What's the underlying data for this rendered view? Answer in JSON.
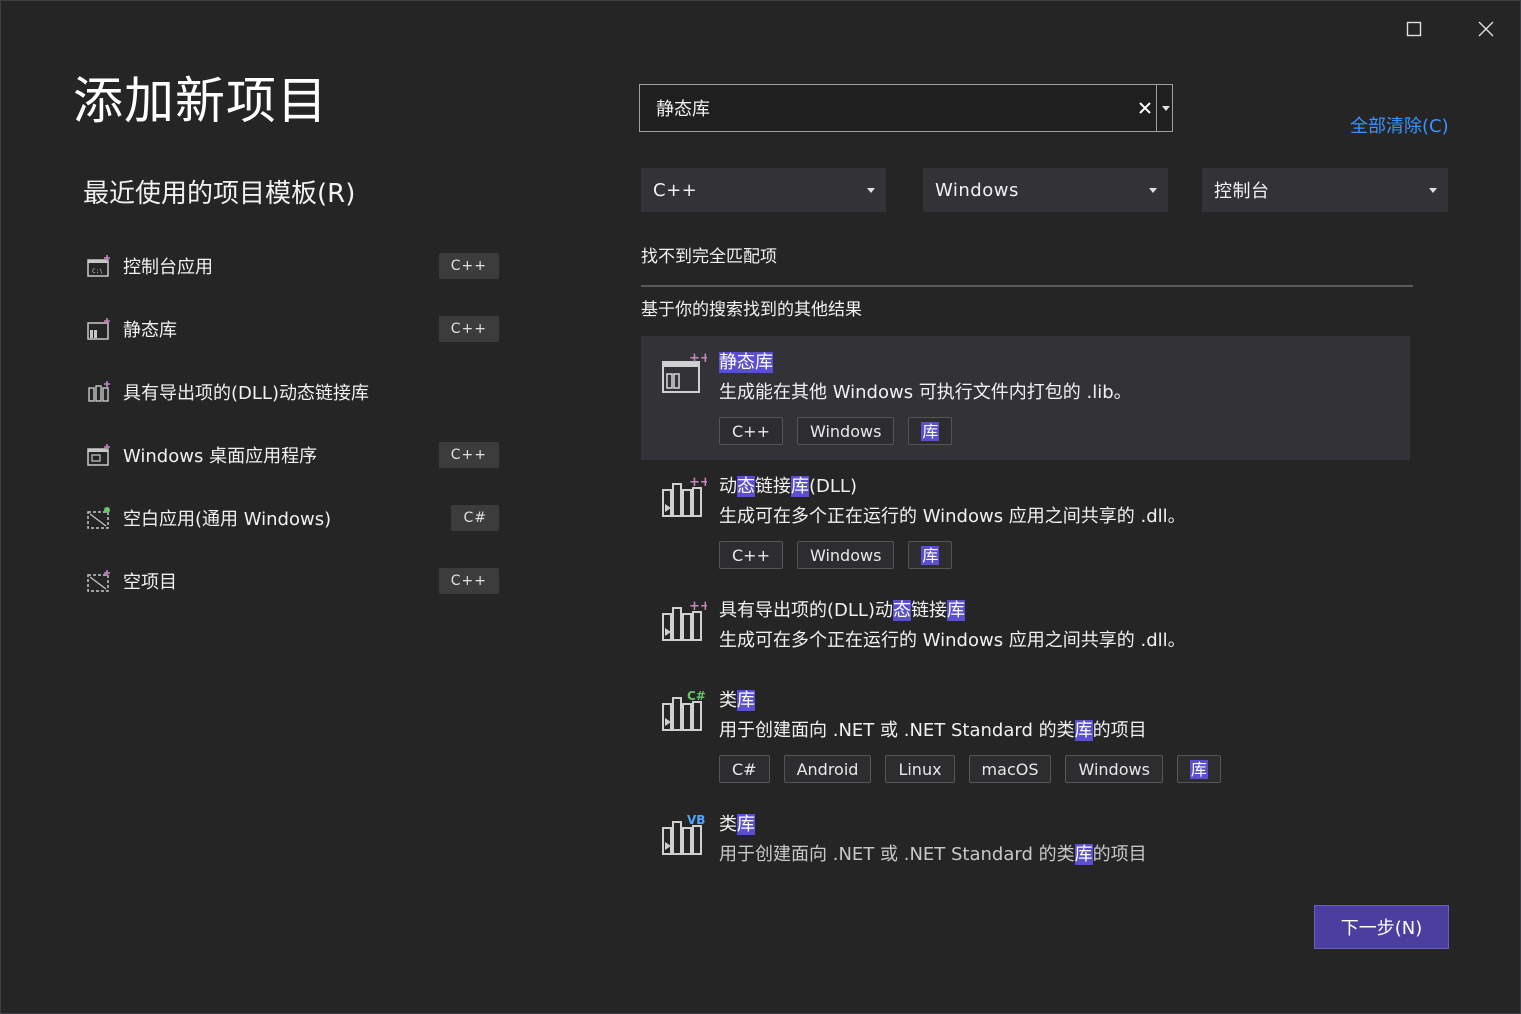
{
  "window": {
    "title": "添加新项目"
  },
  "recent": {
    "heading": "最近使用的项目模板(R)",
    "items": [
      {
        "label": "控制台应用",
        "lang": "C++"
      },
      {
        "label": "静态库",
        "lang": "C++"
      },
      {
        "label": "具有导出项的(DLL)动态链接库",
        "lang": ""
      },
      {
        "label": "Windows 桌面应用程序",
        "lang": "C++"
      },
      {
        "label": "空白应用(通用 Windows)",
        "lang": "C#"
      },
      {
        "label": "空项目",
        "lang": "C++"
      }
    ]
  },
  "search": {
    "value": "静态库",
    "clear_all": "全部清除(C)"
  },
  "filters": {
    "language": "C++",
    "platform": "Windows",
    "project_type": "控制台"
  },
  "results": {
    "no_match": "找不到完全匹配项",
    "other_heading": "基于你的搜索找到的其他结果",
    "items": [
      {
        "title_parts": [
          {
            "t": "静态库",
            "h": true
          }
        ],
        "desc_parts": [
          {
            "t": "生成能在其他 Windows 可执行文件内打包的 .lib。",
            "h": false
          }
        ],
        "tags": [
          {
            "t": "C++"
          },
          {
            "t": "Windows"
          },
          {
            "t": "库",
            "h": true
          }
        ]
      },
      {
        "title_parts": [
          {
            "t": "动",
            "h": false
          },
          {
            "t": "态",
            "h": true
          },
          {
            "t": "链接",
            "h": false
          },
          {
            "t": "库",
            "h": true
          },
          {
            "t": "(DLL)",
            "h": false
          }
        ],
        "desc_parts": [
          {
            "t": "生成可在多个正在运行的 Windows 应用之间共享的 .dll。",
            "h": false
          }
        ],
        "tags": [
          {
            "t": "C++"
          },
          {
            "t": "Windows"
          },
          {
            "t": "库",
            "h": true
          }
        ]
      },
      {
        "title_parts": [
          {
            "t": "具有导出项的(DLL)动",
            "h": false
          },
          {
            "t": "态",
            "h": true
          },
          {
            "t": "链接",
            "h": false
          },
          {
            "t": "库",
            "h": true
          }
        ],
        "desc_parts": [
          {
            "t": "生成可在多个正在运行的 Windows 应用之间共享的 .dll。",
            "h": false
          }
        ],
        "tags": []
      },
      {
        "title_parts": [
          {
            "t": "类",
            "h": false
          },
          {
            "t": "库",
            "h": true
          }
        ],
        "desc_parts": [
          {
            "t": "用于创建面向 .NET 或 .NET Standard 的类",
            "h": false
          },
          {
            "t": "库",
            "h": true
          },
          {
            "t": "的项目",
            "h": false
          }
        ],
        "tags": [
          {
            "t": "C#"
          },
          {
            "t": "Android"
          },
          {
            "t": "Linux"
          },
          {
            "t": "macOS"
          },
          {
            "t": "Windows"
          },
          {
            "t": "库",
            "h": true
          }
        ]
      },
      {
        "title_parts": [
          {
            "t": "类",
            "h": false
          },
          {
            "t": "库",
            "h": true
          }
        ],
        "desc_parts": [
          {
            "t": "用于创建面向 .NET 或 .NET Standard 的类",
            "h": false
          },
          {
            "t": "库",
            "h": true
          },
          {
            "t": "的项目",
            "h": false
          }
        ],
        "tags": []
      }
    ]
  },
  "icons": {
    "cpp_badge": "++",
    "cs_badge": "C#",
    "vb_badge": "VB",
    "colors": {
      "cpp": "#c586c0",
      "cs": "#68c46a",
      "vb": "#4fa3ff"
    }
  },
  "footer": {
    "next_label": "下一步(N)"
  }
}
